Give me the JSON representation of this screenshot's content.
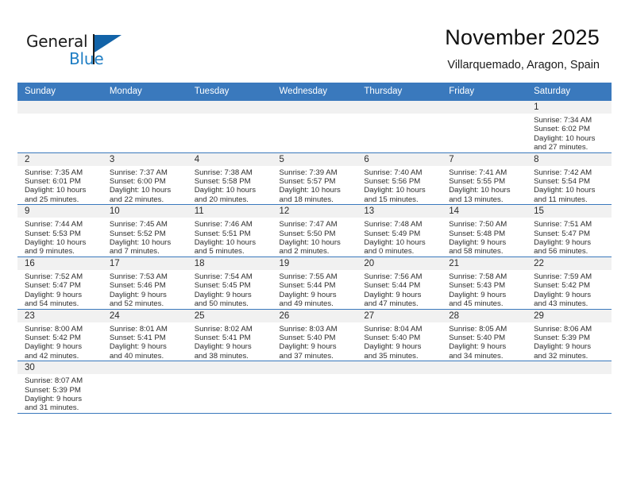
{
  "brand": {
    "name_top": "General",
    "name_bottom": "Blue",
    "color_dark": "#1c1c1c",
    "color_blue": "#1f7ec4",
    "flag_color": "#1263a8"
  },
  "header": {
    "title": "November 2025",
    "subtitle": "Villarquemado, Aragon, Spain"
  },
  "theme": {
    "header_row_bg": "#3a79bd",
    "header_row_text": "#ffffff",
    "daynum_band_bg": "#f1f1f1",
    "cell_border": "#3a79bd"
  },
  "calendar": {
    "weekday_headers": [
      "Sunday",
      "Monday",
      "Tuesday",
      "Wednesday",
      "Thursday",
      "Friday",
      "Saturday"
    ],
    "weeks": [
      [
        {
          "day": "",
          "empty": true
        },
        {
          "day": "",
          "empty": true
        },
        {
          "day": "",
          "empty": true
        },
        {
          "day": "",
          "empty": true
        },
        {
          "day": "",
          "empty": true
        },
        {
          "day": "",
          "empty": true
        },
        {
          "day": "1",
          "sunrise": "Sunrise: 7:34 AM",
          "sunset": "Sunset: 6:02 PM",
          "daylight1": "Daylight: 10 hours",
          "daylight2": "and 27 minutes."
        }
      ],
      [
        {
          "day": "2",
          "sunrise": "Sunrise: 7:35 AM",
          "sunset": "Sunset: 6:01 PM",
          "daylight1": "Daylight: 10 hours",
          "daylight2": "and 25 minutes."
        },
        {
          "day": "3",
          "sunrise": "Sunrise: 7:37 AM",
          "sunset": "Sunset: 6:00 PM",
          "daylight1": "Daylight: 10 hours",
          "daylight2": "and 22 minutes."
        },
        {
          "day": "4",
          "sunrise": "Sunrise: 7:38 AM",
          "sunset": "Sunset: 5:58 PM",
          "daylight1": "Daylight: 10 hours",
          "daylight2": "and 20 minutes."
        },
        {
          "day": "5",
          "sunrise": "Sunrise: 7:39 AM",
          "sunset": "Sunset: 5:57 PM",
          "daylight1": "Daylight: 10 hours",
          "daylight2": "and 18 minutes."
        },
        {
          "day": "6",
          "sunrise": "Sunrise: 7:40 AM",
          "sunset": "Sunset: 5:56 PM",
          "daylight1": "Daylight: 10 hours",
          "daylight2": "and 15 minutes."
        },
        {
          "day": "7",
          "sunrise": "Sunrise: 7:41 AM",
          "sunset": "Sunset: 5:55 PM",
          "daylight1": "Daylight: 10 hours",
          "daylight2": "and 13 minutes."
        },
        {
          "day": "8",
          "sunrise": "Sunrise: 7:42 AM",
          "sunset": "Sunset: 5:54 PM",
          "daylight1": "Daylight: 10 hours",
          "daylight2": "and 11 minutes."
        }
      ],
      [
        {
          "day": "9",
          "sunrise": "Sunrise: 7:44 AM",
          "sunset": "Sunset: 5:53 PM",
          "daylight1": "Daylight: 10 hours",
          "daylight2": "and 9 minutes."
        },
        {
          "day": "10",
          "sunrise": "Sunrise: 7:45 AM",
          "sunset": "Sunset: 5:52 PM",
          "daylight1": "Daylight: 10 hours",
          "daylight2": "and 7 minutes."
        },
        {
          "day": "11",
          "sunrise": "Sunrise: 7:46 AM",
          "sunset": "Sunset: 5:51 PM",
          "daylight1": "Daylight: 10 hours",
          "daylight2": "and 5 minutes."
        },
        {
          "day": "12",
          "sunrise": "Sunrise: 7:47 AM",
          "sunset": "Sunset: 5:50 PM",
          "daylight1": "Daylight: 10 hours",
          "daylight2": "and 2 minutes."
        },
        {
          "day": "13",
          "sunrise": "Sunrise: 7:48 AM",
          "sunset": "Sunset: 5:49 PM",
          "daylight1": "Daylight: 10 hours",
          "daylight2": "and 0 minutes."
        },
        {
          "day": "14",
          "sunrise": "Sunrise: 7:50 AM",
          "sunset": "Sunset: 5:48 PM",
          "daylight1": "Daylight: 9 hours",
          "daylight2": "and 58 minutes."
        },
        {
          "day": "15",
          "sunrise": "Sunrise: 7:51 AM",
          "sunset": "Sunset: 5:47 PM",
          "daylight1": "Daylight: 9 hours",
          "daylight2": "and 56 minutes."
        }
      ],
      [
        {
          "day": "16",
          "sunrise": "Sunrise: 7:52 AM",
          "sunset": "Sunset: 5:47 PM",
          "daylight1": "Daylight: 9 hours",
          "daylight2": "and 54 minutes."
        },
        {
          "day": "17",
          "sunrise": "Sunrise: 7:53 AM",
          "sunset": "Sunset: 5:46 PM",
          "daylight1": "Daylight: 9 hours",
          "daylight2": "and 52 minutes."
        },
        {
          "day": "18",
          "sunrise": "Sunrise: 7:54 AM",
          "sunset": "Sunset: 5:45 PM",
          "daylight1": "Daylight: 9 hours",
          "daylight2": "and 50 minutes."
        },
        {
          "day": "19",
          "sunrise": "Sunrise: 7:55 AM",
          "sunset": "Sunset: 5:44 PM",
          "daylight1": "Daylight: 9 hours",
          "daylight2": "and 49 minutes."
        },
        {
          "day": "20",
          "sunrise": "Sunrise: 7:56 AM",
          "sunset": "Sunset: 5:44 PM",
          "daylight1": "Daylight: 9 hours",
          "daylight2": "and 47 minutes."
        },
        {
          "day": "21",
          "sunrise": "Sunrise: 7:58 AM",
          "sunset": "Sunset: 5:43 PM",
          "daylight1": "Daylight: 9 hours",
          "daylight2": "and 45 minutes."
        },
        {
          "day": "22",
          "sunrise": "Sunrise: 7:59 AM",
          "sunset": "Sunset: 5:42 PM",
          "daylight1": "Daylight: 9 hours",
          "daylight2": "and 43 minutes."
        }
      ],
      [
        {
          "day": "23",
          "sunrise": "Sunrise: 8:00 AM",
          "sunset": "Sunset: 5:42 PM",
          "daylight1": "Daylight: 9 hours",
          "daylight2": "and 42 minutes."
        },
        {
          "day": "24",
          "sunrise": "Sunrise: 8:01 AM",
          "sunset": "Sunset: 5:41 PM",
          "daylight1": "Daylight: 9 hours",
          "daylight2": "and 40 minutes."
        },
        {
          "day": "25",
          "sunrise": "Sunrise: 8:02 AM",
          "sunset": "Sunset: 5:41 PM",
          "daylight1": "Daylight: 9 hours",
          "daylight2": "and 38 minutes."
        },
        {
          "day": "26",
          "sunrise": "Sunrise: 8:03 AM",
          "sunset": "Sunset: 5:40 PM",
          "daylight1": "Daylight: 9 hours",
          "daylight2": "and 37 minutes."
        },
        {
          "day": "27",
          "sunrise": "Sunrise: 8:04 AM",
          "sunset": "Sunset: 5:40 PM",
          "daylight1": "Daylight: 9 hours",
          "daylight2": "and 35 minutes."
        },
        {
          "day": "28",
          "sunrise": "Sunrise: 8:05 AM",
          "sunset": "Sunset: 5:40 PM",
          "daylight1": "Daylight: 9 hours",
          "daylight2": "and 34 minutes."
        },
        {
          "day": "29",
          "sunrise": "Sunrise: 8:06 AM",
          "sunset": "Sunset: 5:39 PM",
          "daylight1": "Daylight: 9 hours",
          "daylight2": "and 32 minutes."
        }
      ],
      [
        {
          "day": "30",
          "sunrise": "Sunrise: 8:07 AM",
          "sunset": "Sunset: 5:39 PM",
          "daylight1": "Daylight: 9 hours",
          "daylight2": "and 31 minutes."
        },
        {
          "day": "",
          "empty": true
        },
        {
          "day": "",
          "empty": true
        },
        {
          "day": "",
          "empty": true
        },
        {
          "day": "",
          "empty": true
        },
        {
          "day": "",
          "empty": true
        },
        {
          "day": "",
          "empty": true
        }
      ]
    ]
  }
}
